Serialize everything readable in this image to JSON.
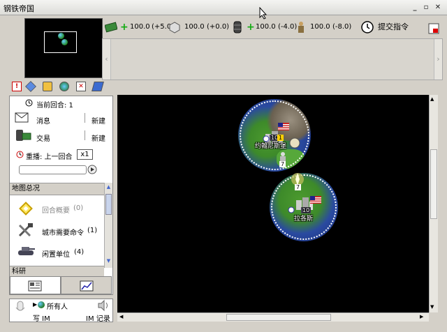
{
  "window": {
    "title": "钢铁帝国",
    "min": "_",
    "max": "▫",
    "close": "✕"
  },
  "resources": [
    {
      "name": "money",
      "value": "100.0",
      "delta": "(+5.0)"
    },
    {
      "name": "production",
      "value": "100.0",
      "delta": "(+0.0)"
    },
    {
      "name": "oil",
      "value": "100.0",
      "delta": "(-4.0)"
    },
    {
      "name": "manpower",
      "value": "100.0",
      "delta": "(-8.0)"
    }
  ],
  "submit_label": "提交指令",
  "panel": {
    "current_turn_label": "当前回合: 1",
    "messages_label": "消息",
    "messages_new": "新建",
    "trade_label": "交易",
    "trade_new": "新建",
    "replay_label": "重播: 上一回合",
    "replay_speed": "x1",
    "map_overview_header": "地图总况",
    "turn_summary": "回合概要",
    "turn_summary_count": "(0)",
    "city_orders": "城市需要命令",
    "city_orders_count": "(1)",
    "idle_units": "闲置单位",
    "idle_units_count": "(4)",
    "research_header": "科研"
  },
  "chat": {
    "recipient": "所有人",
    "write": "写 IM",
    "log": "IM 记录"
  },
  "cities": [
    {
      "name": "约翰尼斯堡",
      "size": "10",
      "flag": "US"
    },
    {
      "name": "拉各斯",
      "size": "10",
      "flag": "US"
    }
  ],
  "units": [
    {
      "count": "1"
    },
    {
      "count": "7"
    },
    {
      "count": "7"
    }
  ],
  "colors": {
    "accent": "#1a6e1a",
    "map_bg": "#000000",
    "ocean": "#1f3f95",
    "land": "#4c9a2e"
  }
}
